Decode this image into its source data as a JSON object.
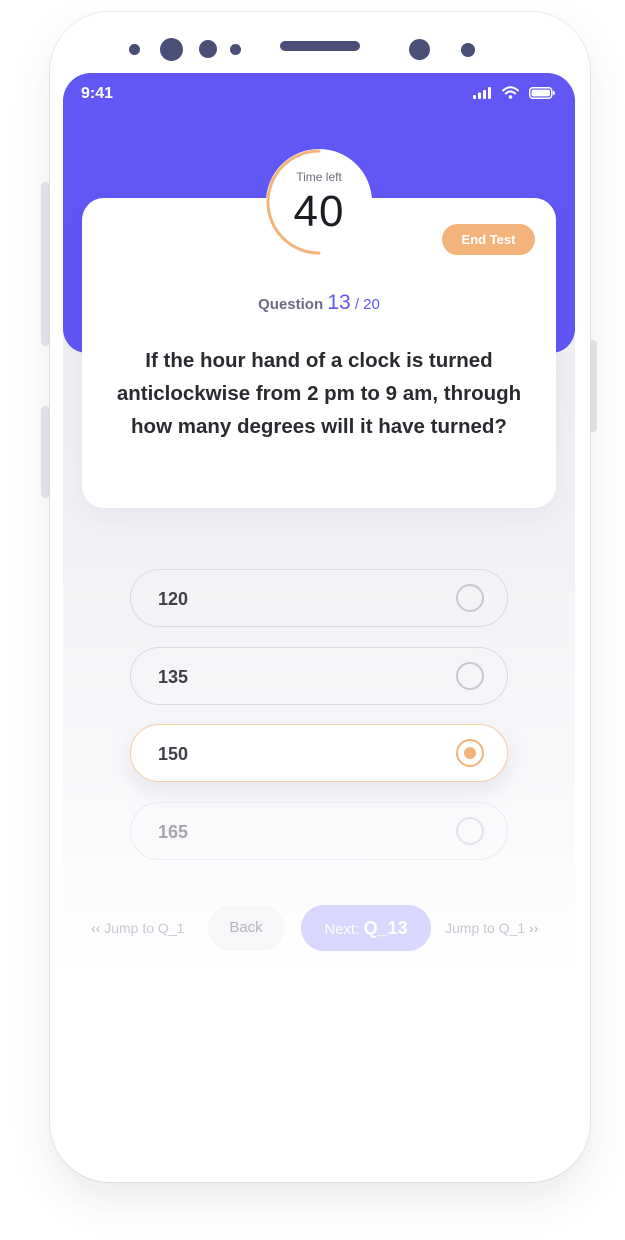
{
  "status_bar": {
    "time": "9:41",
    "icons": [
      "signal-icon",
      "wifi-icon",
      "battery-icon"
    ]
  },
  "timer": {
    "label": "Time left",
    "value": "40"
  },
  "end_test": {
    "label": "End Test"
  },
  "question": {
    "prefix": "Question",
    "current": "13",
    "total": "/ 20",
    "text": "If the hour hand of a clock is turned anticlockwise from 2 pm to 9 am, through how many degrees will it have turned?"
  },
  "options": [
    {
      "label": "120",
      "selected": false
    },
    {
      "label": "135",
      "selected": false
    },
    {
      "label": "150",
      "selected": true
    },
    {
      "label": "165",
      "selected": false
    }
  ],
  "navigation": {
    "jump_prev": "Jump to Q_1",
    "back": "Back",
    "next_prefix": "Next:",
    "next_target": "Q_13",
    "jump_next": "Jump to Q_1"
  },
  "colors": {
    "primary": "#6157f5",
    "accent": "#f2b47a",
    "next_button": "#d9d7fd"
  }
}
